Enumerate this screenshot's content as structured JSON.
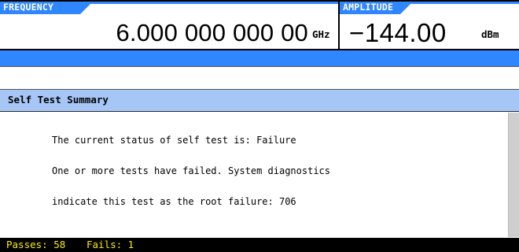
{
  "header": {
    "frequency_label": "FREQUENCY",
    "frequency_value": "6.000 000 000 00",
    "frequency_unit": "GHz",
    "amplitude_label": "AMPLITUDE",
    "amplitude_value": "−144.00",
    "amplitude_unit": "dBm"
  },
  "panel": {
    "title": "Self Test Summary",
    "lines": [
      "The current status of self test is: Failure",
      "One or more tests have failed. System diagnostics",
      "indicate this test as the root failure: 706"
    ]
  },
  "footer": {
    "passes": "Passes: 58",
    "fails": "Fails: 1"
  },
  "colors": {
    "accent_blue": "#2f86ff",
    "title_bar": "#a6c6f6",
    "footer_bg": "#000000",
    "footer_text": "#ffee00"
  }
}
